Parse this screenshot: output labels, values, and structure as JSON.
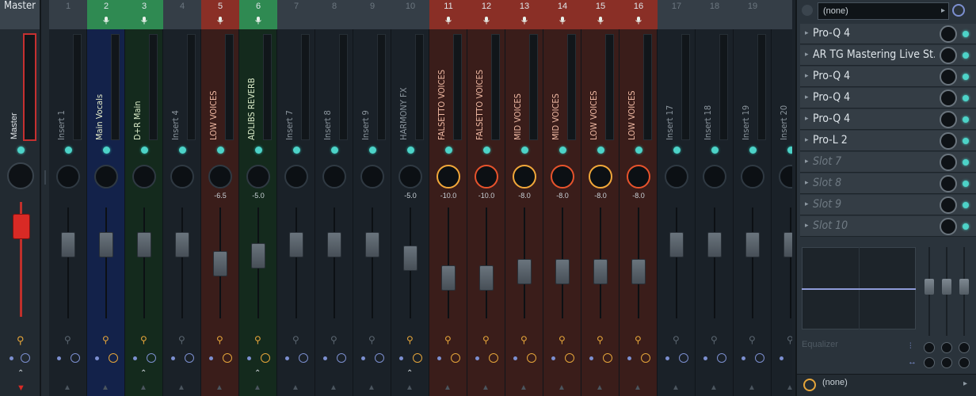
{
  "master": {
    "title": "Master",
    "name": "Master"
  },
  "inserts": [
    {
      "num": "1",
      "label": "Insert 1",
      "color": "dark",
      "mic": false,
      "knob": "none",
      "pan": "",
      "fader": 0.72,
      "linkOn": false,
      "clockOn": false,
      "up": false
    },
    {
      "num": "2",
      "label": "Main Vocals",
      "color": "blue",
      "mic": true,
      "knob": "none",
      "pan": "",
      "fader": 0.72,
      "linkOn": true,
      "clockOn": true,
      "up": false
    },
    {
      "num": "3",
      "label": "D+R Main",
      "color": "green",
      "mic": true,
      "knob": "none",
      "pan": "",
      "fader": 0.72,
      "linkOn": true,
      "clockOn": false,
      "up": true
    },
    {
      "num": "4",
      "label": "Insert 4",
      "color": "dark",
      "mic": false,
      "knob": "none",
      "pan": "",
      "fader": 0.72,
      "linkOn": false,
      "clockOn": false,
      "up": false
    },
    {
      "num": "5",
      "label": "LOW VOICES",
      "color": "red",
      "mic": true,
      "knob": "none",
      "pan": "-6.5",
      "fader": 0.55,
      "linkOn": true,
      "clockOn": true,
      "up": false
    },
    {
      "num": "6",
      "label": "ADLIBS REVERB",
      "color": "green",
      "mic": true,
      "knob": "none",
      "pan": "-5.0",
      "fader": 0.62,
      "linkOn": true,
      "clockOn": true,
      "up": true
    },
    {
      "num": "7",
      "label": "Insert 7",
      "color": "dark",
      "mic": false,
      "knob": "none",
      "pan": "",
      "fader": 0.72,
      "linkOn": false,
      "clockOn": false,
      "up": false
    },
    {
      "num": "8",
      "label": "Insert 8",
      "color": "dark",
      "mic": false,
      "knob": "none",
      "pan": "",
      "fader": 0.72,
      "linkOn": false,
      "clockOn": false,
      "up": false
    },
    {
      "num": "9",
      "label": "Insert 9",
      "color": "dark",
      "mic": false,
      "knob": "none",
      "pan": "",
      "fader": 0.72,
      "linkOn": false,
      "clockOn": false,
      "up": false
    },
    {
      "num": "10",
      "label": "HARMONY FX",
      "color": "dark",
      "mic": false,
      "knob": "none",
      "pan": "-5.0",
      "fader": 0.6,
      "linkOn": true,
      "clockOn": true,
      "up": true
    },
    {
      "num": "11",
      "label": "FALSETTO VOICES",
      "color": "red",
      "mic": true,
      "knob": "warm",
      "pan": "-10.0",
      "fader": 0.42,
      "linkOn": true,
      "clockOn": true,
      "up": false
    },
    {
      "num": "12",
      "label": "FALSETTO VOICES",
      "color": "red",
      "mic": true,
      "knob": "hot",
      "pan": "-10.0",
      "fader": 0.42,
      "linkOn": true,
      "clockOn": true,
      "up": false
    },
    {
      "num": "13",
      "label": "MID VOICES",
      "color": "red",
      "mic": true,
      "knob": "warm",
      "pan": "-8.0",
      "fader": 0.48,
      "linkOn": true,
      "clockOn": true,
      "up": false
    },
    {
      "num": "14",
      "label": "MID VOICES",
      "color": "red",
      "mic": true,
      "knob": "hot",
      "pan": "-8.0",
      "fader": 0.48,
      "linkOn": true,
      "clockOn": true,
      "up": false
    },
    {
      "num": "15",
      "label": "LOW VOICES",
      "color": "red",
      "mic": true,
      "knob": "warm",
      "pan": "-8.0",
      "fader": 0.48,
      "linkOn": true,
      "clockOn": true,
      "up": false
    },
    {
      "num": "16",
      "label": "LOW VOICES",
      "color": "red",
      "mic": true,
      "knob": "hot",
      "pan": "-8.0",
      "fader": 0.48,
      "linkOn": true,
      "clockOn": true,
      "up": false
    },
    {
      "num": "17",
      "label": "Insert 17",
      "color": "dark",
      "mic": false,
      "knob": "none",
      "pan": "",
      "fader": 0.72,
      "linkOn": false,
      "clockOn": false,
      "up": false
    },
    {
      "num": "18",
      "label": "Insert 18",
      "color": "dark",
      "mic": false,
      "knob": "none",
      "pan": "",
      "fader": 0.72,
      "linkOn": false,
      "clockOn": false,
      "up": false
    },
    {
      "num": "19",
      "label": "Insert 19",
      "color": "dark",
      "mic": false,
      "knob": "none",
      "pan": "",
      "fader": 0.72,
      "linkOn": false,
      "clockOn": false,
      "up": false
    },
    {
      "num": "",
      "label": "Insert 20",
      "color": "dark",
      "mic": false,
      "knob": "none",
      "pan": "",
      "fader": 0.72,
      "linkOn": false,
      "clockOn": false,
      "up": false
    }
  ],
  "colors": {
    "dark": "#1a2128",
    "blue": "#13224a",
    "green": "#142a1d",
    "red": "#3a1d1a",
    "hdr_blue": "#353e47",
    "hdr_green": "#2f8a52",
    "hdr_red": "#8a2f26",
    "lbl_dark": "#8a949c",
    "lbl_blue": "#e5ecc8",
    "lbl_green": "#d8e9c6",
    "lbl_red": "#f0b9a3"
  },
  "panel": {
    "preset_top": "(none)",
    "slots": [
      {
        "name": "Pro-Q 4",
        "empty": false
      },
      {
        "name": "AR TG Mastering Live St...",
        "empty": false
      },
      {
        "name": "Pro-Q 4",
        "empty": false
      },
      {
        "name": "Pro-Q 4",
        "empty": false
      },
      {
        "name": "Pro-Q 4",
        "empty": false
      },
      {
        "name": "Pro-L 2",
        "empty": false
      },
      {
        "name": "Slot 7",
        "empty": true
      },
      {
        "name": "Slot 8",
        "empty": true
      },
      {
        "name": "Slot 9",
        "empty": true
      },
      {
        "name": "Slot 10",
        "empty": true
      }
    ],
    "eq_title": "Equalizer",
    "preset_bottom": "(none)"
  }
}
